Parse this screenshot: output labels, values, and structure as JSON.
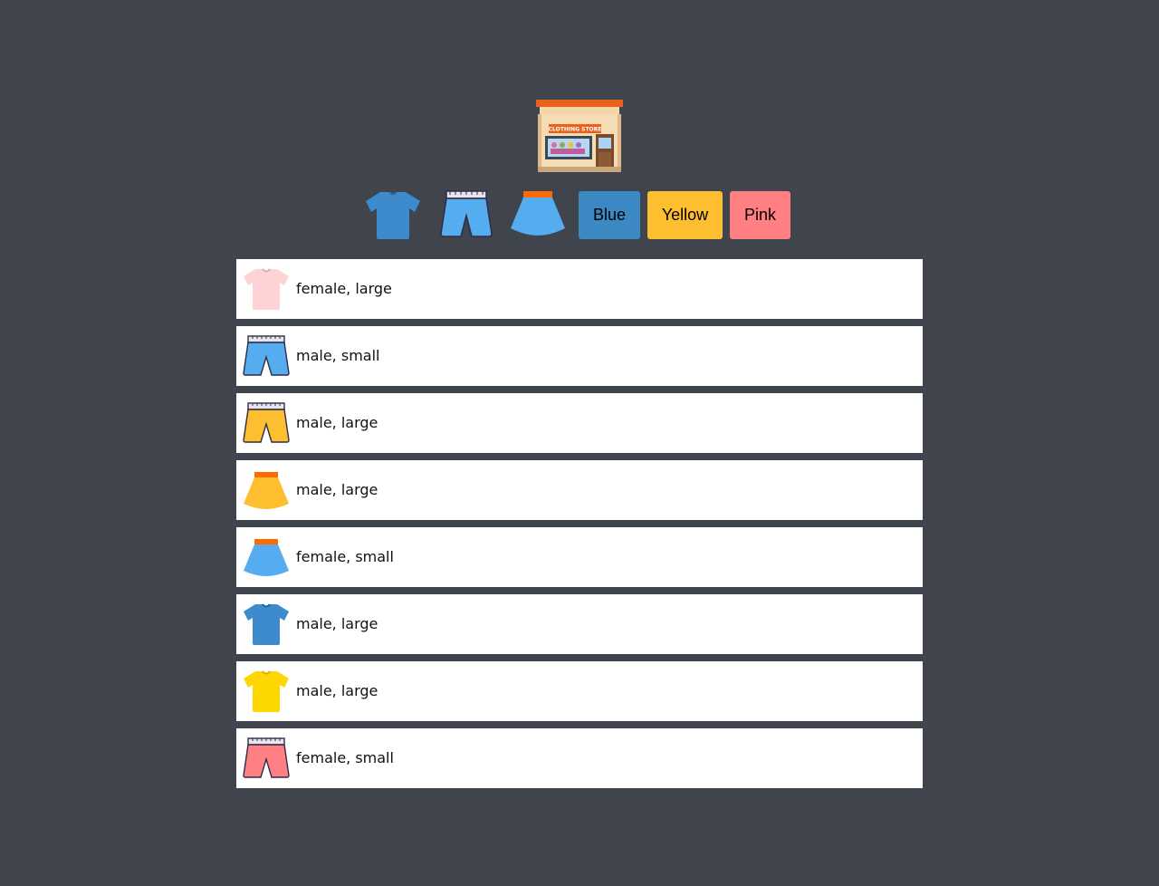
{
  "store": {
    "sign_text": "CLOTHING STORE",
    "icon": "clothing-store-icon"
  },
  "filters": {
    "types": [
      {
        "name": "tshirt",
        "icon": "tshirt-icon",
        "color": "#3d8bcd"
      },
      {
        "name": "shorts",
        "icon": "shorts-icon",
        "color": "#55acee"
      },
      {
        "name": "skirt",
        "icon": "skirt-icon",
        "color": "#55acee"
      }
    ],
    "colors": [
      {
        "label": "Blue",
        "color": "#3b88c3"
      },
      {
        "label": "Yellow",
        "color": "#fdbf2f"
      },
      {
        "label": "Pink",
        "color": "#ff7f82"
      }
    ]
  },
  "items": [
    {
      "type": "tshirt",
      "color": "#ffd3d6",
      "label": "female, large"
    },
    {
      "type": "shorts",
      "color": "#55acee",
      "label": "male, small"
    },
    {
      "type": "shorts",
      "color": "#fdbf2f",
      "label": "male, large"
    },
    {
      "type": "skirt",
      "color": "#fdbf2f",
      "label": "male, large"
    },
    {
      "type": "skirt",
      "color": "#55acee",
      "label": "female, small"
    },
    {
      "type": "tshirt",
      "color": "#3d8bcd",
      "label": "male, large"
    },
    {
      "type": "tshirt",
      "color": "#ffd700",
      "label": "male, large"
    },
    {
      "type": "shorts",
      "color": "#ff7f82",
      "label": "female, small"
    }
  ]
}
